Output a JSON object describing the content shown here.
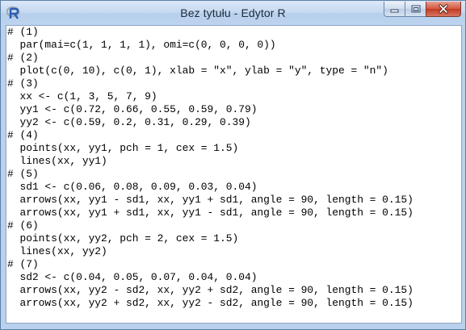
{
  "window": {
    "title": "Bez tytułu - Edytor R",
    "app_icon": "r-logo-icon",
    "buttons": [
      "minimize-icon",
      "maximize-icon",
      "close-icon"
    ],
    "accent": "#b9d1ec",
    "close_color": "#c23a22"
  },
  "editor": {
    "lines": [
      "# (1)",
      "  par(mai=c(1, 1, 1, 1), omi=c(0, 0, 0, 0))",
      "# (2)",
      "  plot(c(0, 10), c(0, 1), xlab = \"x\", ylab = \"y\", type = \"n\")",
      "# (3)",
      "  xx <- c(1, 3, 5, 7, 9)",
      "  yy1 <- c(0.72, 0.66, 0.55, 0.59, 0.79)",
      "  yy2 <- c(0.59, 0.2, 0.31, 0.29, 0.39)",
      "# (4)",
      "  points(xx, yy1, pch = 1, cex = 1.5)",
      "  lines(xx, yy1)",
      "# (5)",
      "  sd1 <- c(0.06, 0.08, 0.09, 0.03, 0.04)",
      "  arrows(xx, yy1 - sd1, xx, yy1 + sd1, angle = 90, length = 0.15)",
      "  arrows(xx, yy1 + sd1, xx, yy1 - sd1, angle = 90, length = 0.15)",
      "# (6)",
      "  points(xx, yy2, pch = 2, cex = 1.5)",
      "  lines(xx, yy2)",
      "# (7)",
      "  sd2 <- c(0.04, 0.05, 0.07, 0.04, 0.04)",
      "  arrows(xx, yy2 - sd2, xx, yy2 + sd2, angle = 90, length = 0.15)",
      "  arrows(xx, yy2 + sd2, xx, yy2 - sd2, angle = 90, length = 0.15)"
    ]
  }
}
